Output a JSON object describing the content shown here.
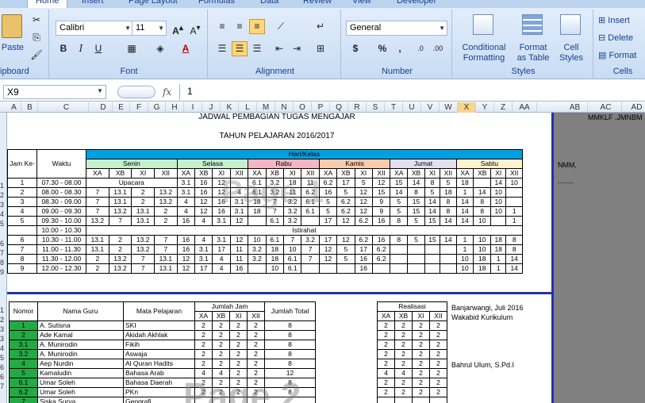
{
  "tabs": [
    "Home",
    "Insert",
    "Page Layout",
    "Formulas",
    "Data",
    "Review",
    "View",
    "Developer"
  ],
  "ribbon": {
    "clipboard": {
      "paste": "Paste",
      "label": "ipboard"
    },
    "font": {
      "name": "Calibri",
      "size": "11",
      "label": "Font"
    },
    "alignment": {
      "label": "Alignment"
    },
    "number": {
      "format": "General",
      "label": "Number"
    },
    "styles": {
      "cond": "Conditional",
      "cond2": "Formatting",
      "table": "Format",
      "table2": "as Table",
      "cell": "Cell",
      "cell2": "Styles",
      "label": "Styles"
    },
    "cells": {
      "insert": "Insert",
      "delete": "Delete",
      "format": "Format",
      "label": "Cells"
    }
  },
  "formula": {
    "cell": "X9",
    "fx": "fx",
    "value": "1"
  },
  "columns": [
    "A",
    "B",
    "C",
    "D",
    "E",
    "F",
    "G",
    "H",
    "I",
    "J",
    "K",
    "L",
    "M",
    "N",
    "O",
    "P",
    "Q",
    "R",
    "S",
    "T",
    "U",
    "V",
    "W",
    "X",
    "Y",
    "Z",
    "AA",
    "AB",
    "AC",
    "AD"
  ],
  "rows": [
    "1",
    "2",
    "3",
    "4",
    "5",
    "6",
    "7",
    "8",
    "9",
    "1",
    "2",
    "3",
    "3",
    "4",
    "5",
    "6",
    "6",
    "7"
  ],
  "sheet": {
    "title": "JADWAL PEMBAGIAN TUGAS MENGAJAR",
    "year": "TAHUN PELAJARAN 2016/2017",
    "side1": "MMKLF ,JMNBM",
    "side2": "NMM,",
    "side3": "........",
    "page1": "Page 1",
    "page2": "Page 2",
    "hari_kelas": "Hari/Kelas",
    "jam_ke": "Jam Ke-",
    "waktu": "Waktu",
    "days": [
      "Senin",
      "Selasa",
      "Rabu",
      "Kamis",
      "Jumat",
      "Sabtu"
    ],
    "day_colors": [
      "#c6efce",
      "#c6efce",
      "#f4b6c2",
      "#f8cbad",
      "#e4dfec",
      "#fff2cc"
    ],
    "classes": [
      "XA",
      "XB",
      "XI",
      "XII"
    ],
    "schedule": [
      [
        "1",
        "07.30 - 08.00",
        "Upacara",
        "",
        "",
        "",
        "3.1",
        "16",
        "12",
        "",
        "6.1",
        "3.2",
        "18",
        "11",
        "6.2",
        "17",
        "5",
        "12",
        "15",
        "14",
        "8",
        "5",
        "18",
        "",
        "14",
        "10"
      ],
      [
        "2",
        "08.00 - 08.30",
        "7",
        "13.1",
        "2",
        "13.2",
        "3.1",
        "16",
        "12",
        "4",
        "6.1",
        "3.2",
        "11",
        "6.2",
        "16",
        "5",
        "12",
        "15",
        "14",
        "8",
        "5",
        "18",
        "1",
        "14",
        "10"
      ],
      [
        "3",
        "08.30 - 09.00",
        "7",
        "13.1",
        "2",
        "13.2",
        "4",
        "12",
        "16",
        "3.1",
        "18",
        "7",
        "3.2",
        "6.1",
        "5",
        "6.2",
        "12",
        "9",
        "5",
        "15",
        "14",
        "8",
        "14",
        "8",
        "10",
        ""
      ],
      [
        "4",
        "09.00 - 09.30",
        "7",
        "13.2",
        "13.1",
        "2",
        "4",
        "12",
        "16",
        "3.1",
        "18",
        "7",
        "3.2",
        "6.1",
        "5",
        "6.2",
        "12",
        "9",
        "5",
        "15",
        "14",
        "8",
        "14",
        "8",
        "10",
        "1"
      ],
      [
        "5",
        "09.30 - 10.00",
        "13.2",
        "7",
        "13.1",
        "2",
        "16",
        "4",
        "3.1",
        "12",
        "",
        "6.1",
        "3.2",
        "",
        "17",
        "12",
        "6.2",
        "16",
        "8",
        "5",
        "15",
        "14",
        "14",
        "10",
        "",
        "1"
      ],
      [
        "",
        "10.00 - 10.30",
        "Istirahat"
      ],
      [
        "6",
        "10.30 - 11.00",
        "13.1",
        "2",
        "13.2",
        "7",
        "16",
        "4",
        "3.1",
        "12",
        "10",
        "6.1",
        "7",
        "3.2",
        "17",
        "12",
        "6.2",
        "16",
        "8",
        "5",
        "15",
        "14",
        "1",
        "10",
        "18",
        "8"
      ],
      [
        "7",
        "11.00 - 11.30",
        "13.1",
        "2",
        "13.2",
        "7",
        "16",
        "3.1",
        "17",
        "11",
        "3.2",
        "18",
        "10",
        "7",
        "12",
        "5",
        "17",
        "6.2",
        "",
        "",
        "",
        "",
        "1",
        "10",
        "18",
        "8"
      ],
      [
        "8",
        "11.30 - 12.00",
        "2",
        "13.2",
        "7",
        "13.1",
        "12",
        "3.1",
        "4",
        "11",
        "3.2",
        "18",
        "6.1",
        "7",
        "12",
        "5",
        "16",
        "6.2",
        "",
        "",
        "",
        "",
        "10",
        "18",
        "1",
        "14"
      ],
      [
        "9",
        "12.00 - 12.30",
        "2",
        "13.2",
        "7",
        "13.1",
        "12",
        "17",
        "4",
        "16",
        "",
        "10",
        "6.1",
        "",
        "",
        "",
        "16",
        "",
        "",
        "",
        "",
        "",
        "10",
        "18",
        "1",
        "14"
      ]
    ],
    "teachers_hdr": {
      "nomor": "Nomor",
      "nama": "Nama Guru",
      "mapel": "Mata Pelajaran",
      "jumlah_jam": "Jumlah Jam",
      "total": "Jumlah Total",
      "realisasi": "Realisasi"
    },
    "teachers": [
      [
        "1",
        "A. Sutisna",
        "SKI",
        "2",
        "2",
        "2",
        "2",
        "8",
        "2",
        "2",
        "2",
        "2"
      ],
      [
        "2",
        "Ade Kamal",
        "Akidah Akhlak",
        "2",
        "2",
        "2",
        "2",
        "8",
        "2",
        "2",
        "2",
        "2"
      ],
      [
        "3.1",
        "A. Munirodin",
        "Fikih",
        "2",
        "2",
        "2",
        "2",
        "8",
        "2",
        "2",
        "2",
        "2"
      ],
      [
        "3.2",
        "A. Munirodin",
        "Aswaja",
        "2",
        "2",
        "2",
        "2",
        "8",
        "2",
        "2",
        "2",
        "2"
      ],
      [
        "4",
        "Aep Nurdin",
        "Al Quran Hadits",
        "2",
        "2",
        "2",
        "2",
        "8",
        "2",
        "2",
        "2",
        "2"
      ],
      [
        "5",
        "Kamaludin",
        "Bahasa Arab",
        "4",
        "4",
        "2",
        "2",
        "12",
        "4",
        "4",
        "2",
        "2"
      ],
      [
        "6.1",
        "Umar Soleh",
        "Bahasa Daerah",
        "2",
        "2",
        "2",
        "2",
        "8",
        "2",
        "2",
        "2",
        "2"
      ],
      [
        "6.2",
        "Umar Soleh",
        "PKn",
        "2",
        "2",
        "2",
        "2",
        "8",
        "2",
        "2",
        "2",
        "2"
      ],
      [
        "7",
        "Siska Surya",
        "Geografi",
        "",
        "",
        "",
        "",
        "",
        "",
        "",
        "",
        ""
      ]
    ],
    "sign": {
      "place": "Banjarwangi,  Juli 2016",
      "role": "Wakabid Kurikulum",
      "name": "Bahrul Ulum, S.Pd.I"
    }
  }
}
